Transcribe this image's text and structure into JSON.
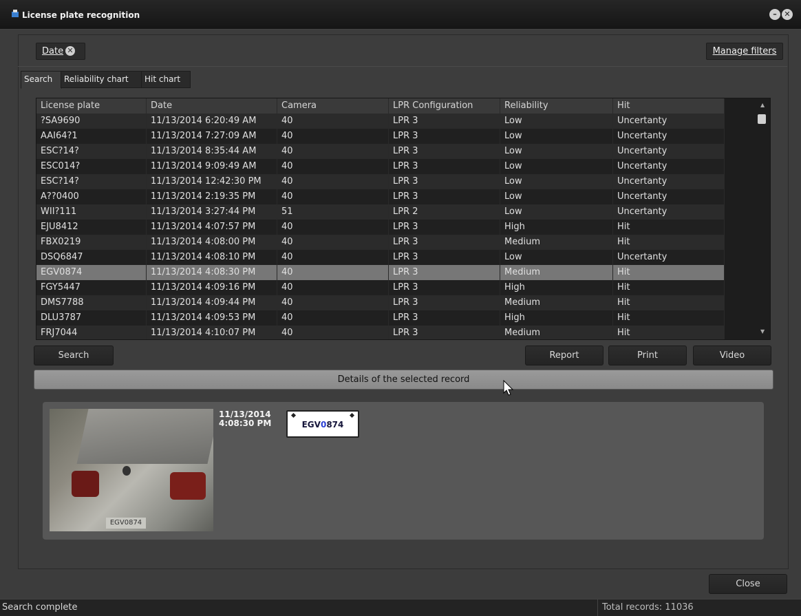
{
  "window": {
    "title": "License plate recognition",
    "minimize_glyph": "–",
    "close_glyph": "✕"
  },
  "filters": {
    "chip_label": "Date",
    "chip_remove_glyph": "✕",
    "manage_label": "Manage filters"
  },
  "tabs": [
    {
      "label": "Search",
      "active": true
    },
    {
      "label": "Reliability chart",
      "active": false
    },
    {
      "label": "Hit chart",
      "active": false
    }
  ],
  "table": {
    "columns": [
      "License plate",
      "Date",
      "Camera",
      "LPR Configuration",
      "Reliability",
      "Hit"
    ],
    "rows": [
      [
        "?SA9690",
        "11/13/2014 6:20:49 AM",
        "40",
        "LPR 3",
        "Low",
        "Uncertanty"
      ],
      [
        "AAI64?1",
        "11/13/2014 7:27:09 AM",
        "40",
        "LPR 3",
        "Low",
        "Uncertanty"
      ],
      [
        "ESC?14?",
        "11/13/2014 8:35:44 AM",
        "40",
        "LPR 3",
        "Low",
        "Uncertanty"
      ],
      [
        "ESC014?",
        "11/13/2014 9:09:49 AM",
        "40",
        "LPR 3",
        "Low",
        "Uncertanty"
      ],
      [
        "ESC?14?",
        "11/13/2014 12:42:30 PM",
        "40",
        "LPR 3",
        "Low",
        "Uncertanty"
      ],
      [
        "A??0400",
        "11/13/2014 2:19:35 PM",
        "40",
        "LPR 3",
        "Low",
        "Uncertanty"
      ],
      [
        "WII?111",
        "11/13/2014 3:27:44 PM",
        "51",
        "LPR 2",
        "Low",
        "Uncertanty"
      ],
      [
        "EJU8412",
        "11/13/2014 4:07:57 PM",
        "40",
        "LPR 3",
        "High",
        "Hit"
      ],
      [
        "FBX0219",
        "11/13/2014 4:08:00 PM",
        "40",
        "LPR 3",
        "Medium",
        "Hit"
      ],
      [
        "DSQ6847",
        "11/13/2014 4:08:10 PM",
        "40",
        "LPR 3",
        "Low",
        "Uncertanty"
      ],
      [
        "EGV0874",
        "11/13/2014 4:08:30 PM",
        "40",
        "LPR 3",
        "Medium",
        "Hit"
      ],
      [
        "FGY5447",
        "11/13/2014 4:09:16 PM",
        "40",
        "LPR 3",
        "High",
        "Hit"
      ],
      [
        "DMS7788",
        "11/13/2014 4:09:44 PM",
        "40",
        "LPR 3",
        "Medium",
        "Hit"
      ],
      [
        "DLU3787",
        "11/13/2014 4:09:53 PM",
        "40",
        "LPR 3",
        "High",
        "Hit"
      ],
      [
        "FRJ7044",
        "11/13/2014 4:10:07 PM",
        "40",
        "LPR 3",
        "Medium",
        "Hit"
      ]
    ],
    "selected_index": 10
  },
  "buttons": {
    "search": "Search",
    "report": "Report",
    "print": "Print",
    "video": "Video",
    "close": "Close"
  },
  "details": {
    "bar_label": "Details of the selected record",
    "date": "11/13/2014",
    "time": "4:08:30 PM",
    "plate_prefix": "EGV",
    "plate_highlight": "0",
    "plate_suffix": "874",
    "photo_plate": "EGV0874"
  },
  "status": {
    "left": "Search complete",
    "right": "Total records: 11036"
  },
  "icons": [
    "app-icon",
    "minimize-icon",
    "close-icon",
    "remove-filter-icon",
    "scroll-up-icon",
    "scroll-down-icon",
    "mouse-cursor-icon"
  ]
}
